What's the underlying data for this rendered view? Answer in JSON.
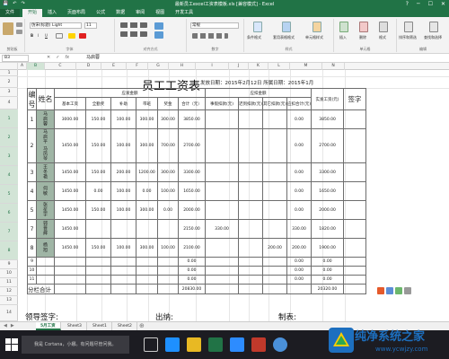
{
  "window": {
    "title": "最新员工excel工资表模板.xls [兼容模式] - Excel",
    "controls": [
      "?",
      "─",
      "☐",
      "✕"
    ]
  },
  "ribbon": {
    "tabs": [
      "文件",
      "开始",
      "插入",
      "页面布局",
      "公式",
      "数据",
      "审阅",
      "视图",
      "开发工具"
    ],
    "active_tab": "开始",
    "font_name": "仿宋(标题) Light",
    "font_size": "11",
    "number_format": "常规",
    "group_labels": [
      "剪贴板",
      "字体",
      "对齐方式",
      "数字",
      "样式",
      "单元格",
      "编辑"
    ],
    "buttons": {
      "cond_format": "条件格式",
      "table_format": "套用表格格式",
      "cell_style": "单元格样式",
      "insert": "插入",
      "delete": "删除",
      "format": "格式",
      "sort_filter": "排序和筛选",
      "find_select": "查找和选择"
    }
  },
  "formula_bar": {
    "name_box": "B3",
    "content": "马启蓉"
  },
  "columns": [
    "A",
    "B",
    "C",
    "D",
    "E",
    "F",
    "G",
    "H",
    "I",
    "J",
    "K",
    "L",
    "M",
    "N"
  ],
  "selected_column": "B",
  "rows": [
    "1",
    "2",
    "3",
    "4",
    "5",
    "6",
    "7",
    "8",
    "9",
    "10",
    "11",
    "12",
    "13",
    "14",
    "15",
    "16",
    "17",
    "18",
    "19",
    "20"
  ],
  "selected_rows": [
    "3",
    "4",
    "5",
    "6",
    "7",
    "8",
    "9",
    "10"
  ],
  "sheet": {
    "title": "员工工资表",
    "issue_date": "发放日期：2015年2月12日 所属日期：2015年1月",
    "headers": {
      "no": "编号",
      "name": "姓名",
      "payable_group": "应发金额",
      "deduction_group": "应扣金额",
      "base": "基本工资",
      "seniority": "全勤奖",
      "subsidy": "补助",
      "overtime": "带班",
      "bonus": "奖金",
      "total": "合计（元）",
      "leave": "事假扣款(元)",
      "social": "迟到扣款(元)",
      "other": "其它扣款(元)",
      "ded_total": "应扣合计(元)",
      "actual": "实发工资(元)",
      "sign": "签字"
    },
    "employees": [
      {
        "no": "1",
        "name": "马启蓉",
        "base": "3000.00",
        "seniority": "150.00",
        "subsidy": "100.00",
        "overtime": "300.00",
        "bonus": "300.00",
        "total": "3850.00",
        "leave": "",
        "social": "",
        "other": "",
        "ded_total": "0.00",
        "actual": "3850.00"
      },
      {
        "no": "2",
        "name": "马启平 马凤琴",
        "base": "1450.00",
        "seniority": "150.00",
        "subsidy": "100.00",
        "overtime": "300.00",
        "bonus": "700.00",
        "total": "2700.00",
        "leave": "",
        "social": "",
        "other": "",
        "ded_total": "0.00",
        "actual": "2700.00"
      },
      {
        "no": "3",
        "name": "王冬艳",
        "base": "1450.00",
        "seniority": "150.00",
        "subsidy": "200.00",
        "overtime": "1200.00",
        "bonus": "300.00",
        "total": "3300.00",
        "leave": "",
        "social": "",
        "other": "",
        "ded_total": "0.00",
        "actual": "3300.00"
      },
      {
        "no": "4",
        "name": "何敏",
        "base": "1450.00",
        "seniority": "0.00",
        "subsidy": "100.00",
        "overtime": "0.00",
        "bonus": "100.00",
        "total": "1650.00",
        "leave": "",
        "social": "",
        "other": "",
        "ded_total": "0.00",
        "actual": "1650.00"
      },
      {
        "no": "5",
        "name": "张星宇",
        "base": "1450.00",
        "seniority": "150.00",
        "subsidy": "100.00",
        "overtime": "300.00",
        "bonus": "0.00",
        "total": "2000.00",
        "leave": "",
        "social": "",
        "other": "",
        "ded_total": "0.00",
        "actual": "2000.00"
      },
      {
        "no": "7",
        "name": "郭晋辉",
        "base": "1450.00",
        "seniority": "",
        "subsidy": "",
        "overtime": "",
        "bonus": "",
        "total": "2150.00",
        "leave": "330.00",
        "social": "",
        "other": "",
        "ded_total": "330.00",
        "actual": "1820.00"
      },
      {
        "no": "8",
        "name": "杨旭",
        "base": "1450.00",
        "seniority": "150.00",
        "subsidy": "100.00",
        "overtime": "300.00",
        "bonus": "100.00",
        "total": "2100.00",
        "leave": "",
        "social": "",
        "other": "200.00",
        "ded_total": "200.00",
        "actual": "1900.00"
      }
    ],
    "blank_rows": [
      {
        "no": "9",
        "total": "0.00",
        "ded_total": "0.00",
        "actual": "0.00"
      },
      {
        "no": "10",
        "total": "0.00",
        "ded_total": "0.00",
        "actual": "0.00"
      },
      {
        "no": "11",
        "total": "0.00",
        "ded_total": "0.00",
        "actual": "0.00"
      }
    ],
    "subtotal": {
      "label": "分栏合计",
      "total": "20830.00",
      "actual": "20320.00"
    },
    "footer": {
      "leader": "领导签字:",
      "cashier": "出纳:",
      "maker": "制表:"
    }
  },
  "sheet_tabs": [
    "5月工资",
    "Sheet3",
    "Sheet1",
    "Sheet2"
  ],
  "active_sheet": "5月工资",
  "taskbar": {
    "search_placeholder": "我是 Cortana，小娜。有问题尽管问我。"
  },
  "watermark": {
    "text": "纯净系统之家",
    "url": "www.ycwjzy.com"
  },
  "colors": {
    "excel_green": "#217346",
    "name_cell": "#9fb5a5",
    "taskbar": "#1c1c22"
  }
}
